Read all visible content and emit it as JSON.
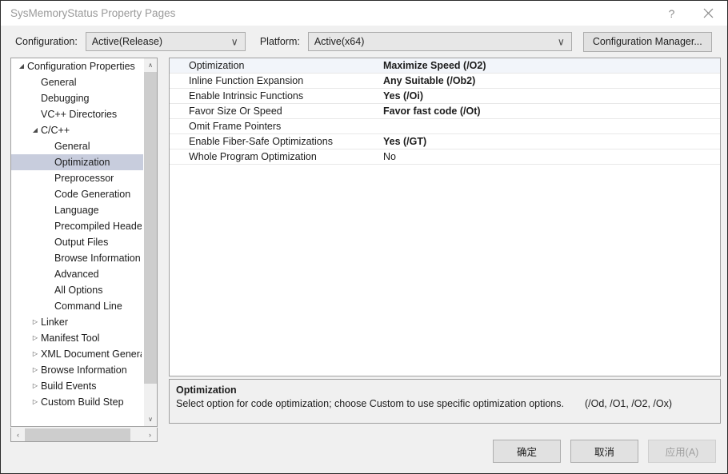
{
  "window": {
    "title": "SysMemoryStatus Property Pages",
    "help_glyph": "?",
    "close_glyph": "×"
  },
  "config_bar": {
    "configuration_label": "Configuration:",
    "configuration_value": "Active(Release)",
    "platform_label": "Platform:",
    "platform_value": "Active(x64)",
    "configuration_manager_label": "Configuration Manager...",
    "dropdown_glyph": "∨"
  },
  "tree": {
    "expanded_glyph": "◢",
    "collapsed_glyph": "▷",
    "scroll_up_glyph": "∧",
    "scroll_down_glyph": "∨",
    "scroll_left_glyph": "‹",
    "scroll_right_glyph": "›",
    "items": [
      {
        "label": "Configuration Properties",
        "indent": 0,
        "state": "expanded",
        "selected": false
      },
      {
        "label": "General",
        "indent": 1,
        "state": "leaf",
        "selected": false
      },
      {
        "label": "Debugging",
        "indent": 1,
        "state": "leaf",
        "selected": false
      },
      {
        "label": "VC++ Directories",
        "indent": 1,
        "state": "leaf",
        "selected": false
      },
      {
        "label": "C/C++",
        "indent": 1,
        "state": "expanded",
        "selected": false
      },
      {
        "label": "General",
        "indent": 2,
        "state": "leaf",
        "selected": false
      },
      {
        "label": "Optimization",
        "indent": 2,
        "state": "leaf",
        "selected": true
      },
      {
        "label": "Preprocessor",
        "indent": 2,
        "state": "leaf",
        "selected": false
      },
      {
        "label": "Code Generation",
        "indent": 2,
        "state": "leaf",
        "selected": false
      },
      {
        "label": "Language",
        "indent": 2,
        "state": "leaf",
        "selected": false
      },
      {
        "label": "Precompiled Headers",
        "indent": 2,
        "state": "leaf",
        "selected": false
      },
      {
        "label": "Output Files",
        "indent": 2,
        "state": "leaf",
        "selected": false
      },
      {
        "label": "Browse Information",
        "indent": 2,
        "state": "leaf",
        "selected": false
      },
      {
        "label": "Advanced",
        "indent": 2,
        "state": "leaf",
        "selected": false
      },
      {
        "label": "All Options",
        "indent": 2,
        "state": "leaf",
        "selected": false
      },
      {
        "label": "Command Line",
        "indent": 2,
        "state": "leaf",
        "selected": false
      },
      {
        "label": "Linker",
        "indent": 1,
        "state": "collapsed",
        "selected": false
      },
      {
        "label": "Manifest Tool",
        "indent": 1,
        "state": "collapsed",
        "selected": false
      },
      {
        "label": "XML Document Generator",
        "indent": 1,
        "state": "collapsed",
        "selected": false
      },
      {
        "label": "Browse Information",
        "indent": 1,
        "state": "collapsed",
        "selected": false
      },
      {
        "label": "Build Events",
        "indent": 1,
        "state": "collapsed",
        "selected": false
      },
      {
        "label": "Custom Build Step",
        "indent": 1,
        "state": "collapsed",
        "selected": false
      }
    ]
  },
  "property_grid": {
    "rows": [
      {
        "name": "Optimization",
        "value": "Maximize Speed (/O2)",
        "bold": true,
        "selected": true
      },
      {
        "name": "Inline Function Expansion",
        "value": "Any Suitable (/Ob2)",
        "bold": true,
        "selected": false
      },
      {
        "name": "Enable Intrinsic Functions",
        "value": "Yes (/Oi)",
        "bold": true,
        "selected": false
      },
      {
        "name": "Favor Size Or Speed",
        "value": "Favor fast code (/Ot)",
        "bold": true,
        "selected": false
      },
      {
        "name": "Omit Frame Pointers",
        "value": "",
        "bold": false,
        "selected": false
      },
      {
        "name": "Enable Fiber-Safe Optimizations",
        "value": "Yes (/GT)",
        "bold": true,
        "selected": false
      },
      {
        "name": "Whole Program Optimization",
        "value": "No",
        "bold": false,
        "selected": false
      }
    ]
  },
  "description": {
    "title": "Optimization",
    "text": "Select option for code optimization; choose Custom to use specific optimization options.",
    "switches": "(/Od, /O1, /O2, /Ox)"
  },
  "footer": {
    "ok_label": "确定",
    "cancel_label": "取消",
    "apply_label": "应用(A)"
  }
}
